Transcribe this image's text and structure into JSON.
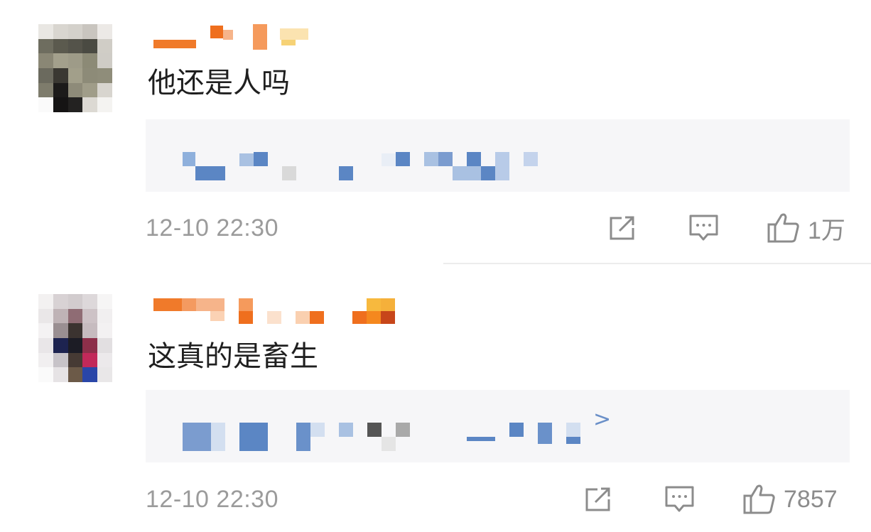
{
  "comments": [
    {
      "text": "他还是人吗",
      "timestamp": "12-10 22:30",
      "likes": "1万",
      "icons": [
        "share-icon",
        "comment-icon",
        "like-icon"
      ]
    },
    {
      "text": "这真的是畜生",
      "timestamp": "12-10 22:30",
      "likes": "7857",
      "icons": [
        "share-icon",
        "comment-icon",
        "like-icon"
      ],
      "reply_arrow": ">"
    }
  ],
  "colors": {
    "username_orange": "#f07a2a",
    "reply_blue": "#5b86c4",
    "meta_gray": "#9b9b9b",
    "reply_bg": "#f6f6f8"
  }
}
